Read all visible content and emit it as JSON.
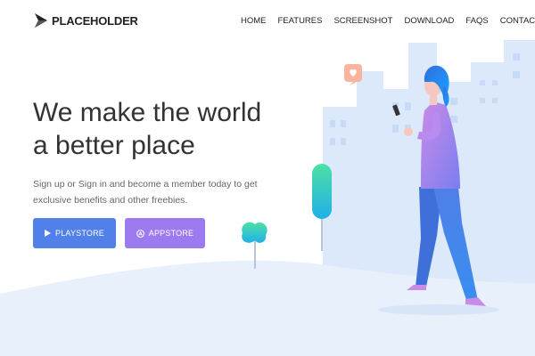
{
  "brand": {
    "name": "PLACEHOLDER"
  },
  "nav": [
    "HOME",
    "FEATURES",
    "SCREENSHOT",
    "DOWNLOAD",
    "FAQS",
    "CONTACT"
  ],
  "hero": {
    "title": "We make the world a better place",
    "subtitle": "Sign up or Sign in and become a member today to get exclusive benefits and other freebies."
  },
  "buttons": {
    "playstore": {
      "label": "PLAYSTORE",
      "icon": "play-icon",
      "color": "#5080e8"
    },
    "appstore": {
      "label": "APPSTORE",
      "icon": "appstore-icon",
      "color": "#9b7bef"
    }
  }
}
